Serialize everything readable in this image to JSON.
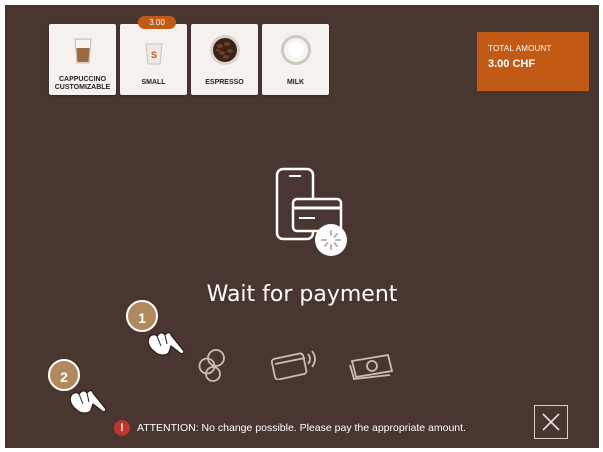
{
  "order": {
    "items": [
      {
        "label": "CAPPUCCINO\nCUSTOMIZABLE",
        "icon": "cappuccino-glass-icon"
      },
      {
        "label": "SMALL",
        "icon": "small-cup-icon",
        "badge": "3.00"
      },
      {
        "label": "ESPRESSO",
        "icon": "espresso-beans-icon"
      },
      {
        "label": "MILK",
        "icon": "milk-cup-icon"
      }
    ]
  },
  "total": {
    "title": "TOTAL AMOUNT",
    "amount": "3.00 CHF"
  },
  "payment": {
    "status": "Wait for payment",
    "methods": [
      "coins-icon",
      "card-contactless-icon",
      "banknote-icon"
    ]
  },
  "steps": [
    "1",
    "2"
  ],
  "notice": {
    "text": "ATTENTION: No change possible. Please pay the appropriate amount.",
    "icon": "warning-icon"
  },
  "colors": {
    "background": "#4a3631",
    "accent": "#c25a15",
    "warning": "#c0352b",
    "step": "#b08a5e"
  }
}
